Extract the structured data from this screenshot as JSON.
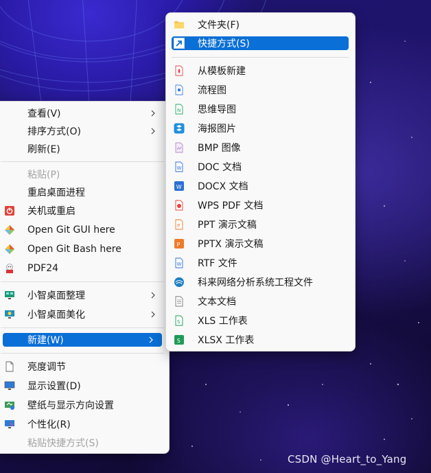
{
  "main_menu": {
    "items": [
      {
        "label": "查看(V)"
      },
      {
        "label": "排序方式(O)"
      },
      {
        "label": "刷新(E)"
      },
      {
        "label": "粘贴(P)"
      },
      {
        "label": "重启桌面进程"
      },
      {
        "label": "关机或重启"
      },
      {
        "label": "Open Git GUI here"
      },
      {
        "label": "Open Git Bash here"
      },
      {
        "label": "PDF24"
      },
      {
        "label": "小智桌面整理"
      },
      {
        "label": "小智桌面美化"
      },
      {
        "label": "新建(W)"
      },
      {
        "label": "亮度调节"
      },
      {
        "label": "显示设置(D)"
      },
      {
        "label": "壁纸与显示方向设置"
      },
      {
        "label": "个性化(R)"
      },
      {
        "label": "粘贴快捷方式(S)"
      }
    ]
  },
  "new_submenu": {
    "items": [
      {
        "label": "文件夹(F)",
        "icon": "folder-icon"
      },
      {
        "label": "快捷方式(S)",
        "icon": "shortcut-icon"
      },
      {
        "label": "从模板新建",
        "icon": "template-icon"
      },
      {
        "label": "流程图",
        "icon": "flowchart-icon"
      },
      {
        "label": "思维导图",
        "icon": "mindmap-icon"
      },
      {
        "label": "海报图片",
        "icon": "poster-icon"
      },
      {
        "label": "BMP 图像",
        "icon": "bmp-icon"
      },
      {
        "label": "DOC 文档",
        "icon": "doc-icon"
      },
      {
        "label": "DOCX 文档",
        "icon": "docx-icon"
      },
      {
        "label": "WPS PDF 文档",
        "icon": "pdf-icon"
      },
      {
        "label": "PPT 演示文稿",
        "icon": "ppt-icon"
      },
      {
        "label": "PPTX 演示文稿",
        "icon": "pptx-icon"
      },
      {
        "label": "RTF 文件",
        "icon": "rtf-icon"
      },
      {
        "label": "科来网络分析系统工程文件",
        "icon": "network-analyzer-icon"
      },
      {
        "label": "文本文档",
        "icon": "text-document-icon"
      },
      {
        "label": "XLS 工作表",
        "icon": "xls-icon"
      },
      {
        "label": "XLSX 工作表",
        "icon": "xlsx-icon"
      }
    ]
  },
  "watermark": "CSDN @Heart_to_Yang",
  "colors": {
    "highlight": "#0a6fd6",
    "menu_bg": "#f9f9f9",
    "disabled": "#a3a3a3"
  }
}
